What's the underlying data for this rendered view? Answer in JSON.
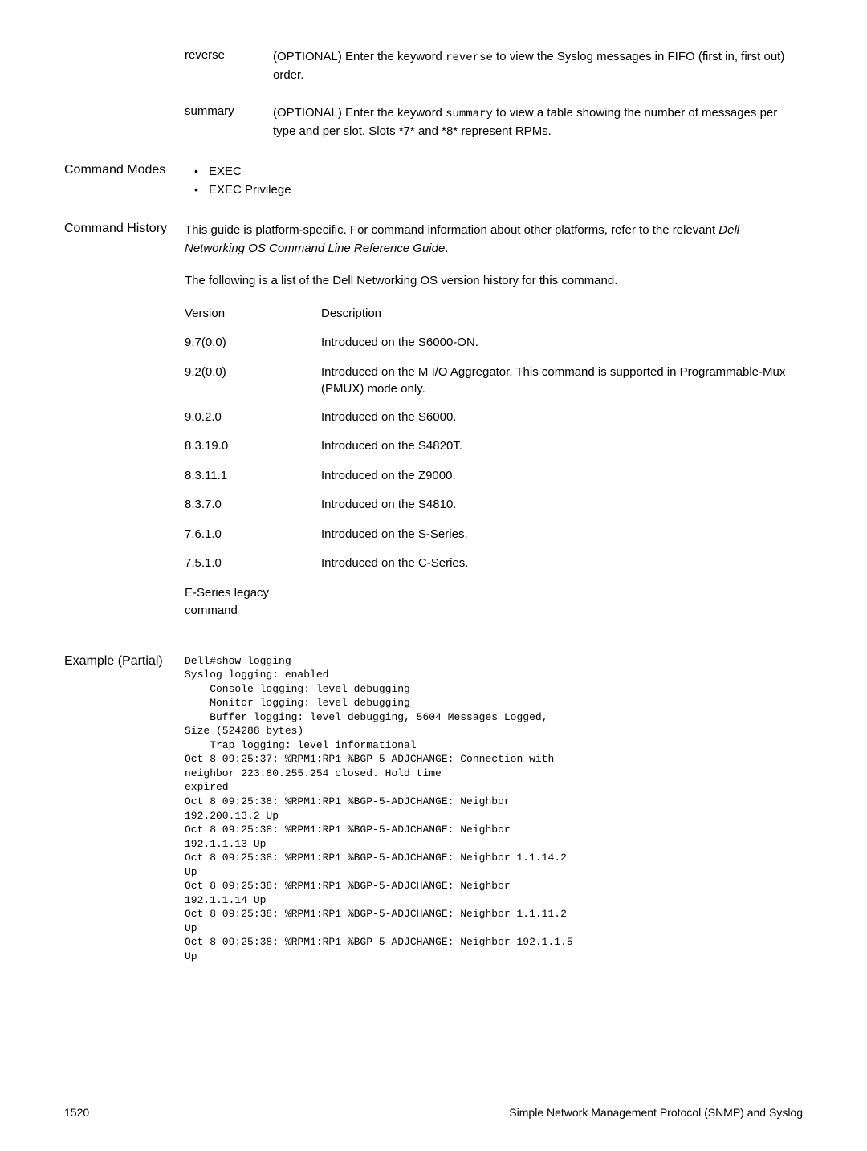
{
  "params": [
    {
      "name": "reverse",
      "desc_pre": "(OPTIONAL) Enter the keyword ",
      "desc_code": "reverse",
      "desc_post": " to view the Syslog messages in FIFO (first in, first out) order."
    },
    {
      "name": "summary",
      "desc_pre": "(OPTIONAL) Enter the keyword ",
      "desc_code": "summary",
      "desc_post": " to view a table showing the number of messages per type and per slot. Slots *7* and *8* represent RPMs."
    }
  ],
  "sections": {
    "command_modes": {
      "label": "Command Modes",
      "items": [
        "EXEC",
        "EXEC Privilege"
      ]
    },
    "command_history": {
      "label": "Command History",
      "intro_pre": "This guide is platform-specific. For command information about other platforms, refer to the relevant ",
      "intro_italic": "Dell Networking OS Command Line Reference Guide",
      "intro_post": ".",
      "subintro": "The following is a list of the Dell Networking OS version history for this command.",
      "version_header": "Version",
      "desc_header": "Description",
      "versions": [
        {
          "v": "9.7(0.0)",
          "d": "Introduced on the S6000-ON."
        },
        {
          "v": "9.2(0.0)",
          "d": "Introduced on the M I/O Aggregator. This command is supported in Programmable-Mux (PMUX) mode only."
        },
        {
          "v": "9.0.2.0",
          "d": "Introduced on the S6000."
        },
        {
          "v": "8.3.19.0",
          "d": "Introduced on the S4820T."
        },
        {
          "v": "8.3.11.1",
          "d": "Introduced on the Z9000."
        },
        {
          "v": "8.3.7.0",
          "d": "Introduced on the S4810."
        },
        {
          "v": "7.6.1.0",
          "d": "Introduced on the S-Series."
        },
        {
          "v": "7.5.1.0",
          "d": "Introduced on the C-Series."
        },
        {
          "v": "E-Series legacy command",
          "d": ""
        }
      ]
    },
    "example": {
      "label": "Example (Partial)",
      "code": "Dell#show logging\nSyslog logging: enabled\n    Console logging: level debugging\n    Monitor logging: level debugging\n    Buffer logging: level debugging, 5604 Messages Logged,\nSize (524288 bytes)\n    Trap logging: level informational\nOct 8 09:25:37: %RPM1:RP1 %BGP-5-ADJCHANGE: Connection with\nneighbor 223.80.255.254 closed. Hold time\nexpired\nOct 8 09:25:38: %RPM1:RP1 %BGP-5-ADJCHANGE: Neighbor\n192.200.13.2 Up\nOct 8 09:25:38: %RPM1:RP1 %BGP-5-ADJCHANGE: Neighbor\n192.1.1.13 Up\nOct 8 09:25:38: %RPM1:RP1 %BGP-5-ADJCHANGE: Neighbor 1.1.14.2\nUp\nOct 8 09:25:38: %RPM1:RP1 %BGP-5-ADJCHANGE: Neighbor\n192.1.1.14 Up\nOct 8 09:25:38: %RPM1:RP1 %BGP-5-ADJCHANGE: Neighbor 1.1.11.2\nUp\nOct 8 09:25:38: %RPM1:RP1 %BGP-5-ADJCHANGE: Neighbor 192.1.1.5\nUp"
    }
  },
  "footer": {
    "page": "1520",
    "title": "Simple Network Management Protocol (SNMP) and Syslog"
  }
}
